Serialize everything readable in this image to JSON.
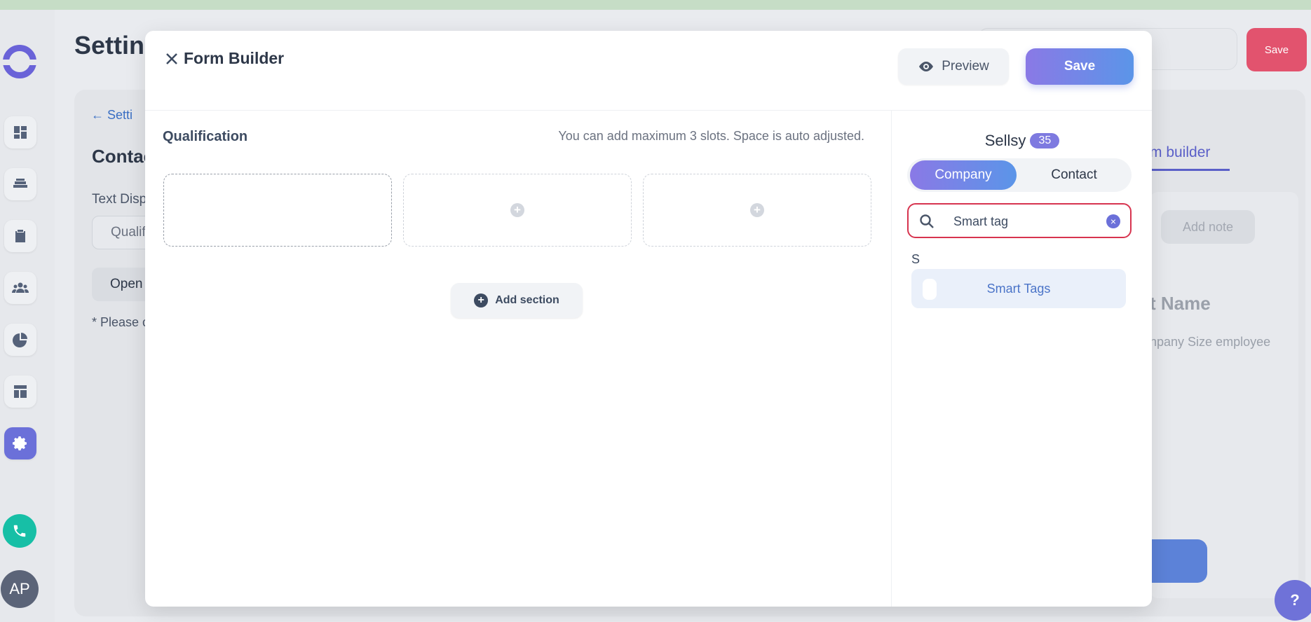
{
  "background": {
    "page_title": "Settin",
    "save_label": "Save",
    "back_label": "Setti",
    "contact_heading": "Contac",
    "text_display_label": "Text Disp",
    "text_display_value": "Qualif",
    "open_button": "Open",
    "please_note": "* Please c",
    "tab_label": "m builder",
    "add_note_label": "Add note",
    "name_heading": "t Name",
    "company_size_label": "npany Size employee"
  },
  "modal": {
    "title": "Form Builder",
    "preview_label": "Preview",
    "save_label": "Save",
    "section_title": "Qualification",
    "slots_hint": "You can add maximum 3 slots. Space is auto adjusted.",
    "add_section_label": "Add section"
  },
  "fields_panel": {
    "provider": "Sellsy",
    "count": "35",
    "tabs": [
      {
        "label": "Company",
        "active": true
      },
      {
        "label": "Contact",
        "active": false
      }
    ],
    "search": {
      "value": "Smart tag"
    },
    "group_letter": "S",
    "results": [
      {
        "label": "Smart Tags"
      }
    ]
  },
  "user": {
    "initials": "AP"
  },
  "colors": {
    "accent": "#6b70d9",
    "danger": "#e2536e",
    "teal": "#17bfa6"
  }
}
